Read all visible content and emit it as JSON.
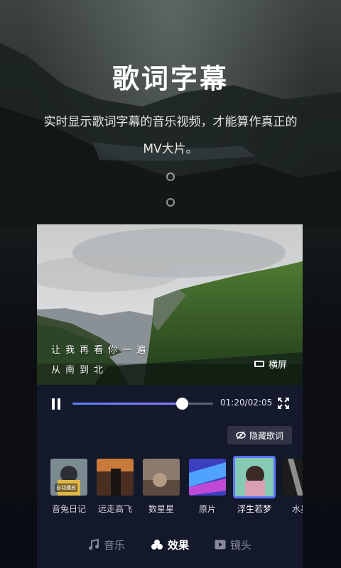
{
  "hero": {
    "title": "歌词字幕",
    "description_line1": "实时显示歌词字幕的音乐视频，才能算作真正的",
    "description_line2": "MV大片。"
  },
  "player": {
    "lyric_line1": "让我再看你一遍",
    "lyric_line2": "从南到北",
    "landscape_label": "横屏",
    "time": "01:20/02:05",
    "progress": 0.78
  },
  "hide_lyrics_label": "隐藏歌词",
  "effects": [
    {
      "label": "音兔日记",
      "tag": "自动播放"
    },
    {
      "label": "远走高飞"
    },
    {
      "label": "数星星"
    },
    {
      "label": "原片"
    },
    {
      "label": "浮生若梦",
      "selected": true
    },
    {
      "label": "水墨"
    }
  ],
  "tabs": [
    {
      "label": "音乐",
      "icon": "music-note-icon"
    },
    {
      "label": "效果",
      "icon": "effects-icon",
      "active": true
    },
    {
      "label": "镜头",
      "icon": "play-icon"
    }
  ],
  "colors": {
    "accent": "#5a74ff",
    "panel": "#13182a"
  }
}
